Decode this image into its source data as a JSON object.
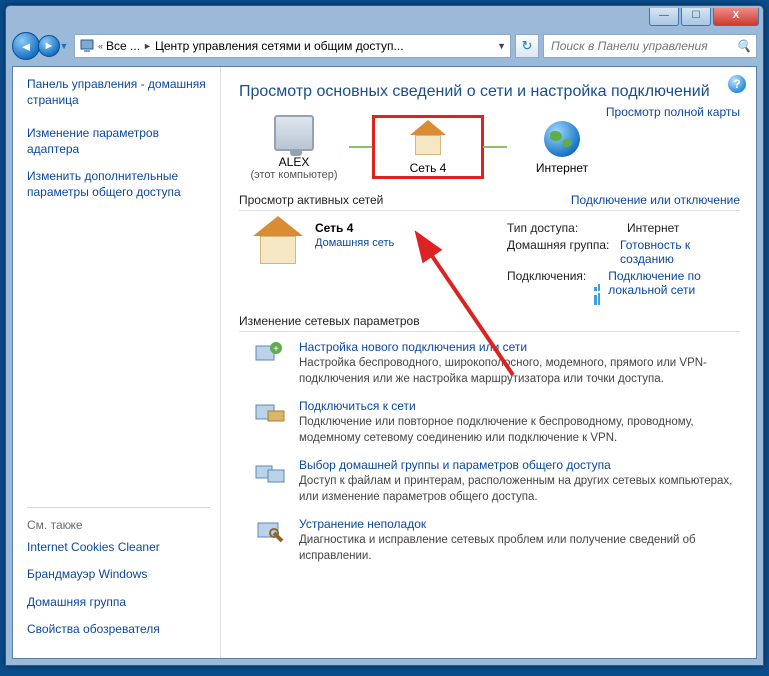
{
  "window": {
    "min": "—",
    "max": "☐",
    "close": "X"
  },
  "addr": {
    "back_glyph": "◄",
    "fwd_glyph": "►",
    "dd_glyph": "▼",
    "crumb_overflow": "«",
    "crumb1": "Все ...",
    "crumb2": "Центр управления сетями и общим доступ...",
    "sep": "►",
    "refresh": "↻",
    "search_placeholder": "Поиск в Панели управления",
    "search_icon": "🔍"
  },
  "help_glyph": "?",
  "sidebar": {
    "home": "Панель управления - домашняя страница",
    "links": [
      "Изменение параметров адаптера",
      "Изменить дополнительные параметры общего доступа"
    ],
    "also_label": "См. также",
    "also": [
      "Internet Cookies Cleaner",
      "Брандмауэр Windows",
      "Домашняя группа",
      "Свойства обозревателя"
    ]
  },
  "main": {
    "title": "Просмотр основных сведений о сети и настройка подключений",
    "nodes": {
      "pc_name": "ALEX",
      "pc_sub": "(этот компьютер)",
      "net_name": "Сеть  4",
      "internet": "Интернет"
    },
    "full_map": "Просмотр полной карты",
    "actives_head": "Просмотр активных сетей",
    "actives_link": "Подключение или отключение",
    "active": {
      "name": "Сеть  4",
      "type": "Домашняя сеть"
    },
    "kv": {
      "k1": "Тип доступа:",
      "v1": "Интернет",
      "k2": "Домашняя группа:",
      "v2": "Готовность к созданию",
      "k3": "Подключения:",
      "v3": "Подключение по локальной сети"
    },
    "settings_head": "Изменение сетевых параметров",
    "tasks": [
      {
        "title": "Настройка нового подключения или сети",
        "desc": "Настройка беспроводного, широкополосного, модемного, прямого или VPN-подключения или же настройка маршрутизатора или точки доступа."
      },
      {
        "title": "Подключиться к сети",
        "desc": "Подключение или повторное подключение к беспроводному, проводному, модемному сетевому соединению или подключение к VPN."
      },
      {
        "title": "Выбор домашней группы и параметров общего доступа",
        "desc": "Доступ к файлам и принтерам, расположенным на других сетевых компьютерах, или изменение параметров общего доступа."
      },
      {
        "title": "Устранение неполадок",
        "desc": "Диагностика и исправление сетевых проблем или получение сведений об исправлении."
      }
    ]
  }
}
